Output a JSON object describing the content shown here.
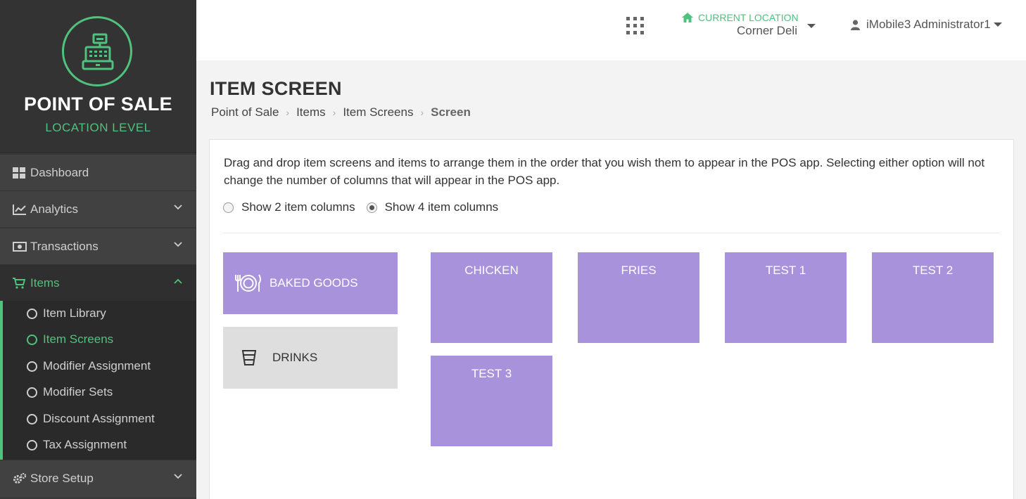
{
  "brand": {
    "title": "POINT OF SALE",
    "subtitle": "LOCATION LEVEL",
    "accent": "#4fc27d"
  },
  "sidebar": {
    "items": [
      {
        "label": "Dashboard"
      },
      {
        "label": "Analytics"
      },
      {
        "label": "Transactions"
      },
      {
        "label": "Items"
      },
      {
        "label": "Store Setup"
      }
    ],
    "sub_items": [
      {
        "label": "Item Library"
      },
      {
        "label": "Item Screens"
      },
      {
        "label": "Modifier Assignment"
      },
      {
        "label": "Modifier Sets"
      },
      {
        "label": "Discount Assignment"
      },
      {
        "label": "Tax Assignment"
      }
    ]
  },
  "topbar": {
    "location_label": "CURRENT LOCATION",
    "location_value": "Corner Deli",
    "user_name": "iMobile3 Administrator1"
  },
  "page": {
    "title": "ITEM SCREEN",
    "breadcrumb": [
      "Point of Sale",
      "Items",
      "Item Screens",
      "Screen"
    ],
    "description": "Drag and drop item screens and items to arrange them in the order that you wish them to appear in the POS app. Selecting either option will not change the number of columns that will appear in the POS app.",
    "radio_options": [
      {
        "label": "Show 2 item columns",
        "checked": false
      },
      {
        "label": "Show 4 item columns",
        "checked": true
      }
    ]
  },
  "screens": [
    {
      "label": "BAKED GOODS",
      "icon": "plate-cutlery-icon",
      "selected": true
    },
    {
      "label": "DRINKS",
      "icon": "cup-icon",
      "selected": false
    }
  ],
  "items": [
    {
      "label": "CHICKEN"
    },
    {
      "label": "FRIES"
    },
    {
      "label": "TEST 1"
    },
    {
      "label": "TEST 2"
    },
    {
      "label": "TEST 3"
    }
  ],
  "colors": {
    "tile_purple": "#a992dc",
    "tile_grey": "#dedede",
    "sidebar_bg": "#3a3a3a"
  }
}
